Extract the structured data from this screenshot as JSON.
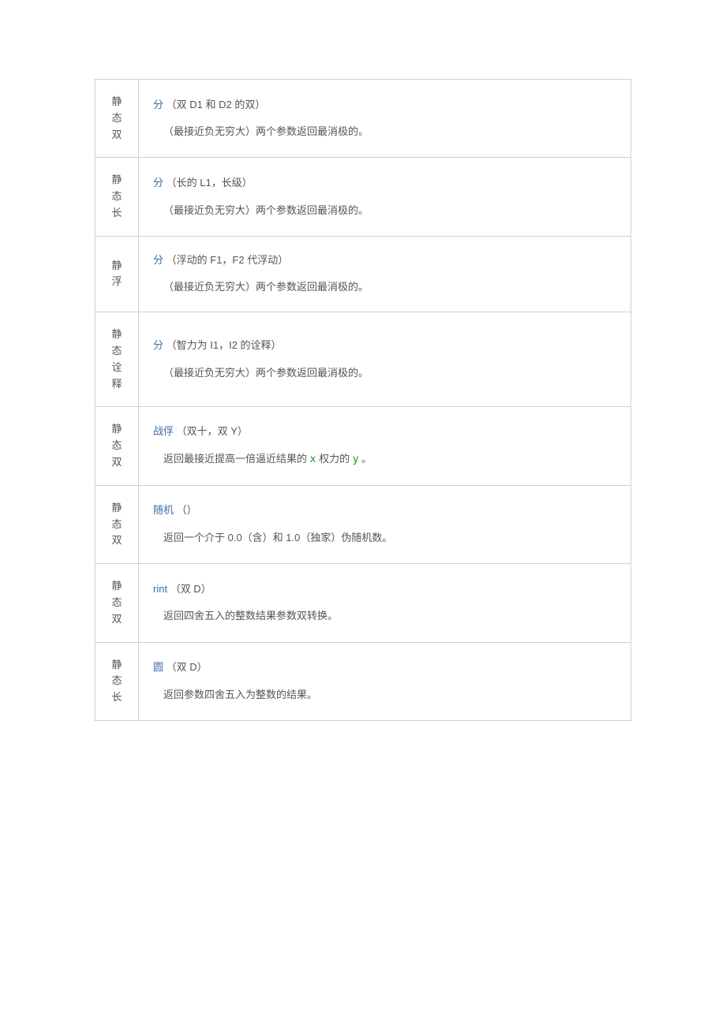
{
  "rows": [
    {
      "modifier": "静态双",
      "method": "分",
      "params": "（双 D1 和 D2 的双）",
      "desc_pre": "（最接近负无穷大）两个参数返回最消极的。",
      "desc_mid": "",
      "desc_var1": "",
      "desc_mid2": "",
      "desc_var2": "",
      "desc_post": ""
    },
    {
      "modifier": "静态长",
      "method": "分",
      "params": "（长的 L1，长级）",
      "desc_pre": "（最接近负无穷大）两个参数返回最消极的。",
      "desc_mid": "",
      "desc_var1": "",
      "desc_mid2": "",
      "desc_var2": "",
      "desc_post": ""
    },
    {
      "modifier": "静浮",
      "method": "分",
      "params": "（浮动的 F1，F2 代浮动）",
      "desc_pre": "（最接近负无穷大）两个参数返回最消极的。",
      "desc_mid": "",
      "desc_var1": "",
      "desc_mid2": "",
      "desc_var2": "",
      "desc_post": ""
    },
    {
      "modifier": "静态诠释",
      "method": "分",
      "params": "（智力为 I1，I2 的诠释）",
      "desc_pre": "（最接近负无穷大）两个参数返回最消极的。",
      "desc_mid": "",
      "desc_var1": "",
      "desc_mid2": "",
      "desc_var2": "",
      "desc_post": ""
    },
    {
      "modifier": "静态双",
      "method": "战俘",
      "params": "（双十，双 Y）",
      "desc_pre": "返回最接近提高一倍逼近结果的 ",
      "desc_var1": "x",
      "desc_mid2": " 权力的 ",
      "desc_var2": "y",
      "desc_post": " 。"
    },
    {
      "modifier": "静态双",
      "method": "随机",
      "params": "（）",
      "desc_pre": "返回一个介于 0.0（含）和 1.0（独家）伪随机数。",
      "desc_var1": "",
      "desc_mid2": "",
      "desc_var2": "",
      "desc_post": ""
    },
    {
      "modifier": "静态双",
      "method": "rint",
      "params": "（双 D）",
      "desc_pre": "返回四舍五入的整数结果参数双转换。",
      "desc_var1": "",
      "desc_mid2": "",
      "desc_var2": "",
      "desc_post": ""
    },
    {
      "modifier": "静态长",
      "method": "圆",
      "params": "（双 D）",
      "desc_pre": "返回参数四舍五入为整数的结果。",
      "desc_var1": "",
      "desc_mid2": "",
      "desc_var2": "",
      "desc_post": ""
    }
  ]
}
